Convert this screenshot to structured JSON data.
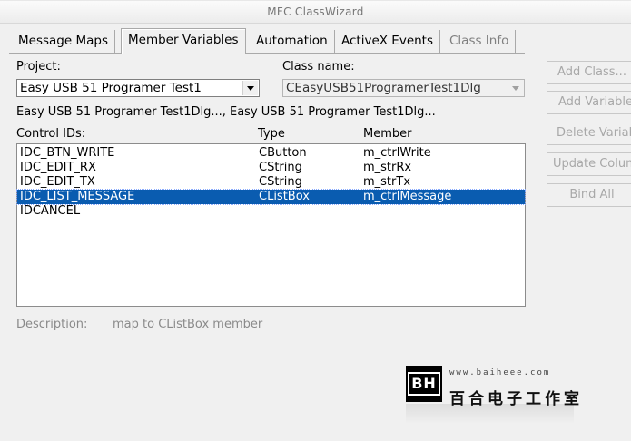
{
  "window": {
    "title": "MFC ClassWizard"
  },
  "tabs": [
    {
      "label": "Message Maps",
      "active": false,
      "enabled": true
    },
    {
      "label": "Member Variables",
      "active": true,
      "enabled": true
    },
    {
      "label": "Automation",
      "active": false,
      "enabled": true
    },
    {
      "label": "ActiveX Events",
      "active": false,
      "enabled": true
    },
    {
      "label": "Class Info",
      "active": false,
      "enabled": false
    }
  ],
  "project": {
    "label": "Project:",
    "value": "Easy USB 51 Programer Test1"
  },
  "class_name": {
    "label": "Class name:",
    "value": "CEasyUSB51ProgramerTest1Dlg"
  },
  "files_line": "Easy USB 51 Programer Test1Dlg..., Easy USB 51 Programer Test1Dlg...",
  "table": {
    "headers": [
      "Control IDs:",
      "Type",
      "Member"
    ],
    "rows": [
      {
        "id": "IDC_BTN_WRITE",
        "type": "CButton",
        "member": "m_ctrlWrite",
        "selected": false
      },
      {
        "id": "IDC_EDIT_RX",
        "type": "CString",
        "member": "m_strRx",
        "selected": false
      },
      {
        "id": "IDC_EDIT_TX",
        "type": "CString",
        "member": "m_strTx",
        "selected": false
      },
      {
        "id": "IDC_LIST_MESSAGE",
        "type": "CListBox",
        "member": "m_ctrlMessage",
        "selected": true
      },
      {
        "id": "IDCANCEL",
        "type": "",
        "member": "",
        "selected": false
      }
    ]
  },
  "description": {
    "label": "Description:",
    "value": "map to CListBox member"
  },
  "buttons": {
    "add_class": "Add Class...",
    "add_variable": "Add Variable...",
    "delete_variable": "Delete Variable",
    "update_columns": "Update Columns",
    "bind_all": "Bind All"
  },
  "watermark": {
    "logo": "BH",
    "url": "www.baiheee.com",
    "name": "百合电子工作室"
  },
  "colors": {
    "selection": "#0a5cb0",
    "disabled_text": "#a8a8a8"
  }
}
